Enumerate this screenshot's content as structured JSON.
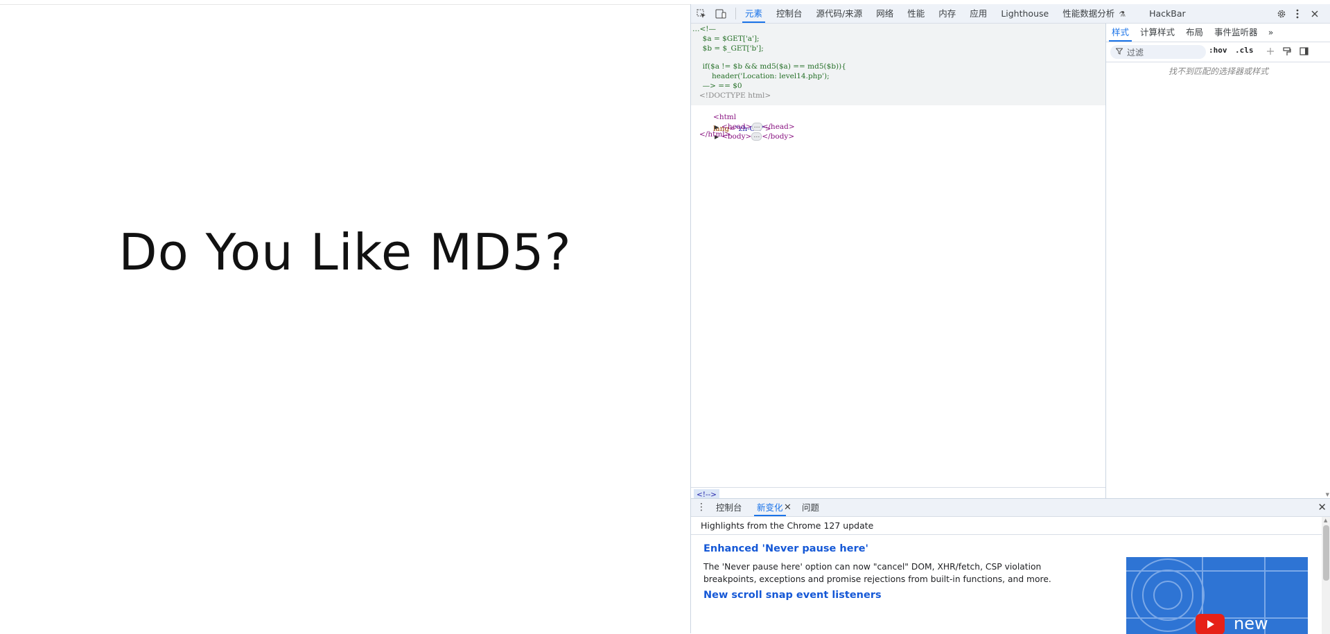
{
  "page": {
    "heading": "Do You Like MD5?"
  },
  "devtools": {
    "main_tabs": [
      {
        "label": "元素",
        "active": true
      },
      {
        "label": "控制台"
      },
      {
        "label": "源代码/来源"
      },
      {
        "label": "网络"
      },
      {
        "label": "性能"
      },
      {
        "label": "内存"
      },
      {
        "label": "应用"
      },
      {
        "label": "Lighthouse"
      },
      {
        "label": "性能数据分析"
      },
      {
        "label": "HackBar"
      }
    ],
    "elements": {
      "comment_open": "…<!—",
      "code_line_1": "  $a = $GET['a'];",
      "code_line_2": "  $b = $_GET['b'];",
      "code_line_3": "  if($a != $b && md5($a) == md5($b)){",
      "code_line_4": "      header('Location: level14.php');",
      "comment_close": "  —> == $0",
      "doctype": "<!DOCTYPE html>",
      "html_open_tag": "<html",
      "html_lang_attr": "lang",
      "html_lang_val": "\"zh-CN\"",
      "html_open_end": ">",
      "head_open": "<head>",
      "head_close": "</head>",
      "body_open": "<body>",
      "body_close": "</body>",
      "html_close": "</html>",
      "ellipsis": "…",
      "breadcrumb": "<!-->"
    },
    "styles_pane": {
      "tabs": [
        {
          "label": "样式",
          "active": true
        },
        {
          "label": "计算样式"
        },
        {
          "label": "布局"
        },
        {
          "label": "事件监听器"
        }
      ],
      "more_tabs": "»",
      "filter_placeholder": "过滤",
      "hov": ":hov",
      "cls": ".cls",
      "no_match": "找不到匹配的选择器或样式"
    },
    "drawer": {
      "tabs": [
        {
          "label": "控制台"
        },
        {
          "label": "新变化",
          "active": true
        },
        {
          "label": "问题"
        }
      ],
      "heading": "Highlights from the Chrome 127 update",
      "features": [
        {
          "title": "Enhanced 'Never pause here'",
          "desc": "The 'Never pause here' option can now \"cancel\" DOM, XHR/fetch, CSP violation breakpoints, exceptions and promise rejections from built-in functions, and more."
        },
        {
          "title": "New scroll snap event listeners",
          "desc": ""
        }
      ],
      "promo_text": "new"
    }
  }
}
